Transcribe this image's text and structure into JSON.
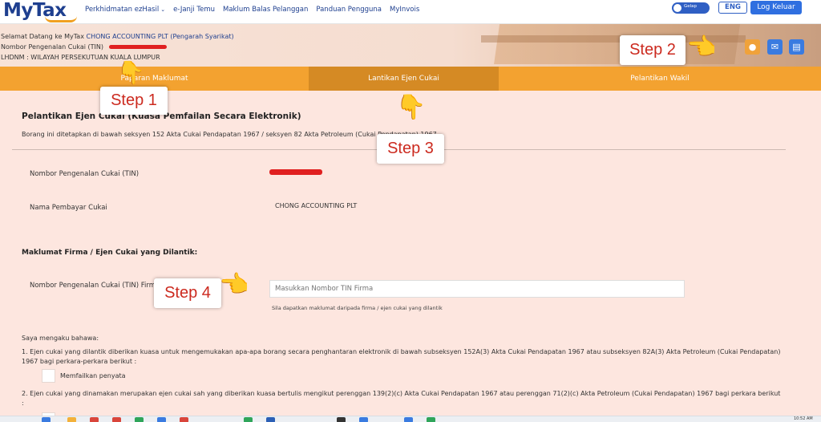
{
  "nav": {
    "logo_my": "My",
    "logo_tax": "Tax",
    "links": [
      {
        "label": "Perkhidmatan ezHasil",
        "dropdown": true
      },
      {
        "label": "e-Janji Temu"
      },
      {
        "label": "Maklum Balas Pelanggan"
      },
      {
        "label": "Panduan Pengguna"
      },
      {
        "label": "MyInvois"
      }
    ],
    "toggle_label": "Gelap",
    "lang_label": "ENG",
    "logout_label": "Log Keluar"
  },
  "header": {
    "welcome_prefix": "Selamat Datang ke MyTax",
    "company": "CHONG ACCOUNTING PLT (Pengarah Syarikat)",
    "tin_label": "Nombor Pengenalan Cukai (TIN)",
    "lhdnm_label": "LHDNM : WILAYAH PERSEKUTUAN KUALA LUMPUR",
    "icons": [
      "profile-icon",
      "mail-icon",
      "book-icon"
    ]
  },
  "tabs": [
    {
      "label": "Paparan Maklumat",
      "active": false
    },
    {
      "label": "Lantikan Ejen Cukai",
      "active": true
    },
    {
      "label": "Pelantikan Wakil",
      "active": false
    }
  ],
  "form": {
    "title": "Pelantikan Ejen Cukai (Kuasa Pemfailan Secara Elektronik)",
    "description": "Borang ini ditetapkan di bawah seksyen 152 Akta Cukai Pendapatan 1967 / seksyen 82 Akta Petroleum (Cukai Pendapatan) 1967",
    "tin_label": "Nombor Pengenalan Cukai (TIN)",
    "nama_label": "Nama Pembayar Cukai",
    "nama_value": "CHONG ACCOUNTING PLT",
    "section2_title": "Maklumat Firma / Ejen Cukai yang Dilantik:",
    "tin_firma_label": "Nombor Pengenalan Cukai (TIN) Firma",
    "tin_firma_placeholder": "Masukkan Nombor TIN Firma",
    "tin_firma_help": "Sila dapatkan maklumat daripada firma / ejen cukai yang dilantik",
    "declare_intro": "Saya mengaku bahawa:",
    "decl_1": "1. Ejen cukai yang dilantik diberikan kuasa untuk mengemukakan apa-apa borang secara penghantaran elektronik di bawah subseksyen 152A(3) Akta Cukai Pendapatan 1967 atau subseksyen 82A(3) Akta Petroleum (Cukai Pendapatan) 1967 bagi perkara-perkara berikut :",
    "chk_1_label": "Memfailkan penyata",
    "decl_2": "2. Ejen cukai yang dinamakan merupakan ejen cukai sah yang diberikan kuasa bertulis mengikut perenggan 139(2)(c) Akta Cukai Pendapatan 1967 atau perenggan 71(2)(c) Akta Petroleum (Cukai Pendapatan) 1967 bagi perkara berikut :"
  },
  "steps": {
    "step1": "Step 1",
    "step2": "Step 2",
    "step3": "Step 3",
    "step4": "Step 4"
  },
  "taskbar": {
    "clock": "10:52 AM"
  },
  "colors": {
    "brand_blue": "#1e3f8f",
    "tab_orange": "#f3a230",
    "tab_active": "#d58a24",
    "page_bg": "#fde6df",
    "step_text": "#cc2a1f",
    "redaction": "#e02020"
  }
}
